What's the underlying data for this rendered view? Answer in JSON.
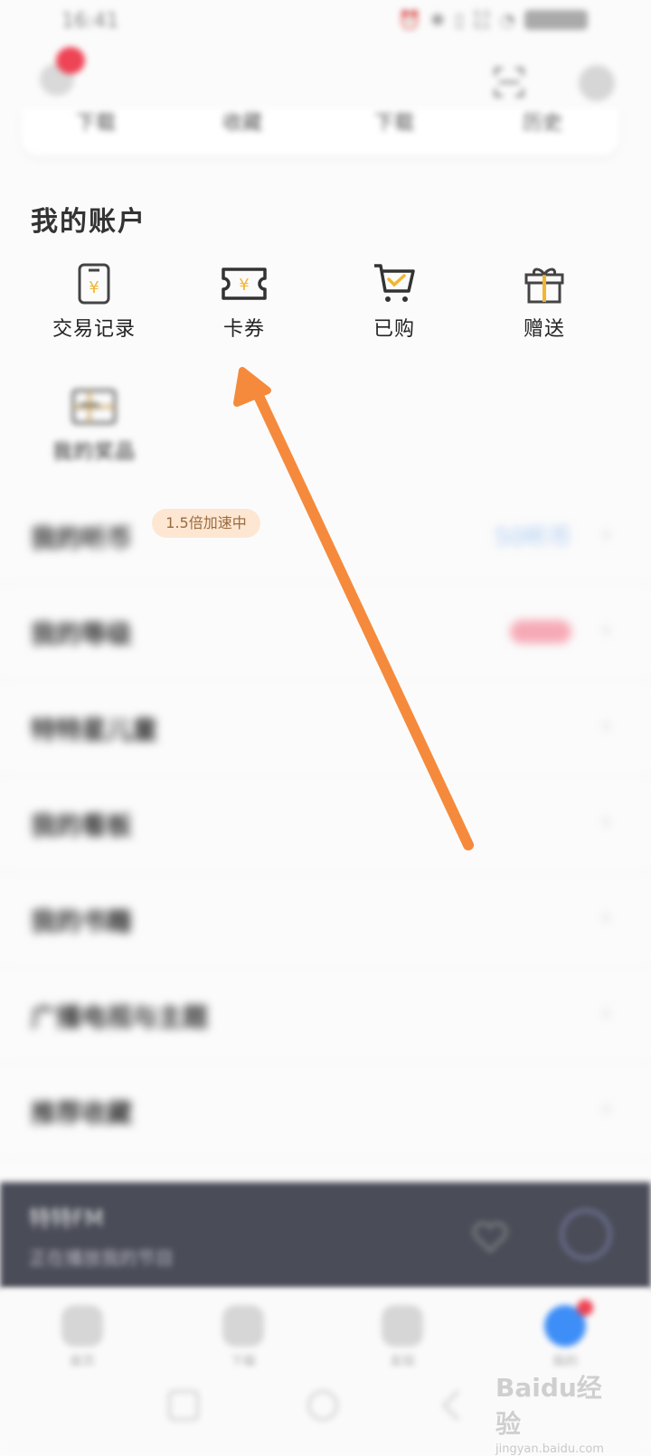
{
  "status_bar": {
    "time": "16:41",
    "net_speed_value": "9.6",
    "net_speed_unit": "K/s"
  },
  "quick_bar": {
    "items": [
      "下载",
      "收藏",
      "下载",
      "历史"
    ]
  },
  "account": {
    "title": "我的账户",
    "items": [
      {
        "label": "交易记录",
        "icon": "phone-yuan-icon"
      },
      {
        "label": "卡券",
        "icon": "coupon-yuan-icon"
      },
      {
        "label": "已购",
        "icon": "cart-check-icon"
      },
      {
        "label": "赠送",
        "icon": "gift-icon"
      },
      {
        "label": "我的奖品",
        "icon": "prize-box-icon"
      }
    ]
  },
  "badge": {
    "speed_text": "1.5倍加速中"
  },
  "list": {
    "rows": [
      {
        "label": "我的听币",
        "right": "50听币"
      },
      {
        "label": "我的等级",
        "right": ""
      },
      {
        "label": "特特星儿童",
        "right": ""
      },
      {
        "label": "我的看板",
        "right": ""
      },
      {
        "label": "我的书籍",
        "right": ""
      },
      {
        "label": "广播电视与主题",
        "right": ""
      },
      {
        "label": "推荐收藏",
        "right": ""
      }
    ],
    "chevron": "›"
  },
  "player": {
    "title": "特特FM",
    "subtitle": "正在播放我的节目",
    "heart_icon": "heart-icon",
    "play_icon": "play-icon"
  },
  "tabs": [
    {
      "label": "首页",
      "icon": "home-icon"
    },
    {
      "label": "下载",
      "icon": "download-icon"
    },
    {
      "label": "发现",
      "icon": "discover-icon"
    },
    {
      "label": "我的",
      "icon": "profile-icon"
    }
  ],
  "watermark": {
    "brand": "Baidu经验",
    "url": "jingyan.baidu.com"
  },
  "colors": {
    "accent_arrow": "#f58a3c",
    "icon_yellow": "#f3b531",
    "tab_active": "#3e8ef7",
    "player_bg": "#4a4c58"
  }
}
